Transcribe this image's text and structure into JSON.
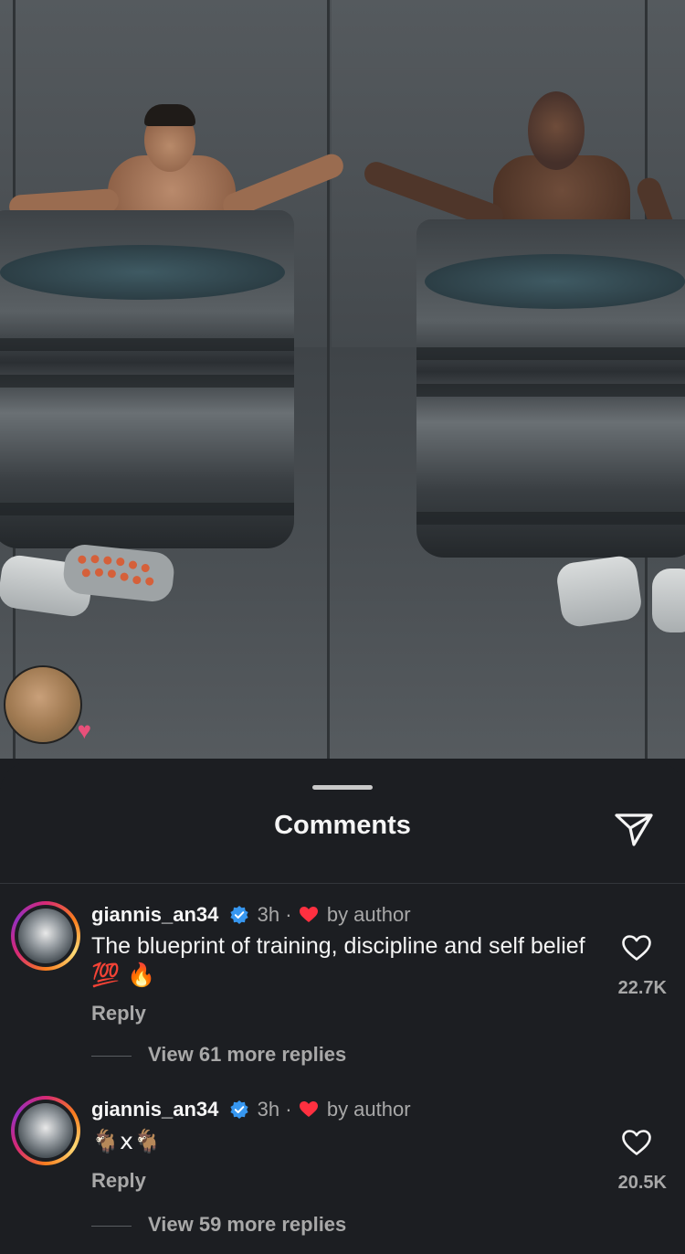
{
  "sheet": {
    "title": "Comments"
  },
  "comments": [
    {
      "username": "giannis_an34",
      "time": "3h",
      "separator": "·",
      "liked_by": "by author",
      "text": "The blueprint of training, discipline and self belief",
      "emoji": "💯 🔥",
      "reply_label": "Reply",
      "likes": "22.7K",
      "view_more": "View 61 more replies"
    },
    {
      "username": "giannis_an34",
      "time": "3h",
      "separator": "·",
      "liked_by": "by author",
      "text": "🐐x🐐",
      "reply_label": "Reply",
      "likes": "20.5K",
      "view_more": "View 59 more replies"
    }
  ],
  "colors": {
    "background": "#1c1e22",
    "secondary_text": "#a8a8a8",
    "verified_blue": "#3797f0",
    "heart_red": "#ff3040"
  },
  "icons": [
    "share-icon",
    "verified-badge-icon",
    "red-heart-icon",
    "heart-outline-icon"
  ]
}
